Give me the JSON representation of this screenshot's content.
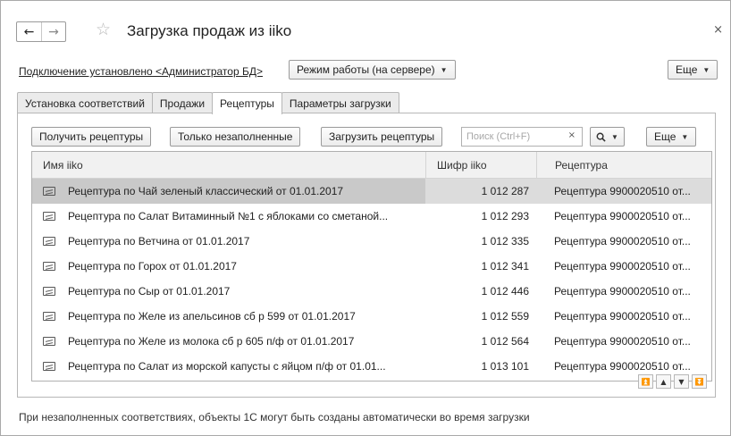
{
  "window": {
    "title": "Загрузка продаж из iiko",
    "close_label": "×",
    "back_label": "←",
    "forward_label": "→",
    "star_label": "☆"
  },
  "connection": {
    "status_link": "Подключение установлено <Администратор БД>",
    "mode_button": "Режим работы (на сервере)",
    "more_button": "Еще"
  },
  "tabs": [
    {
      "label": "Установка соответствий",
      "active": false
    },
    {
      "label": "Продажи",
      "active": false
    },
    {
      "label": "Рецептуры",
      "active": true
    },
    {
      "label": "Параметры загрузки",
      "active": false
    }
  ],
  "toolbar": {
    "get_recipes": "Получить рецептуры",
    "only_unfilled": "Только незаполненные",
    "load_recipes": "Загрузить рецептуры",
    "search_placeholder": "Поиск (Ctrl+F)",
    "search_value": "",
    "clear_label": "×",
    "search_icon_label": "🔍",
    "more_label": "Еще"
  },
  "table": {
    "columns": [
      "Имя iiko",
      "Шифр iiko",
      "Рецептура"
    ],
    "rows": [
      {
        "name": "Рецептура по Чай зеленый классический  от 01.01.2017",
        "code": "1 012 287",
        "recipe": "Рецептура 9900020510 от...",
        "selected": true
      },
      {
        "name": "Рецептура по Салат Витаминный №1 с яблоками со сметаной...",
        "code": "1 012 293",
        "recipe": "Рецептура 9900020510 от...",
        "selected": false
      },
      {
        "name": "Рецептура по Ветчина от 01.01.2017",
        "code": "1 012 335",
        "recipe": "Рецептура 9900020510 от...",
        "selected": false
      },
      {
        "name": "Рецептура по Горох от 01.01.2017",
        "code": "1 012 341",
        "recipe": "Рецептура 9900020510 от...",
        "selected": false
      },
      {
        "name": "Рецептура по Сыр от 01.01.2017",
        "code": "1 012 446",
        "recipe": "Рецептура 9900020510 от...",
        "selected": false
      },
      {
        "name": "Рецептура по Желе из апельсинов сб р 599 от 01.01.2017",
        "code": "1 012 559",
        "recipe": "Рецептура 9900020510 от...",
        "selected": false
      },
      {
        "name": "Рецептура по Желе из молока сб р 605 п/ф от 01.01.2017",
        "code": "1 012 564",
        "recipe": "Рецептура 9900020510 от...",
        "selected": false
      },
      {
        "name": "Рецептура по Салат из морской капусты с яйцом п/ф от 01.01...",
        "code": "1 013 101",
        "recipe": "Рецептура 9900020510 от...",
        "selected": false
      }
    ]
  },
  "scroll": {
    "first_label": "⏫",
    "up_label": "▲",
    "down_label": "▼",
    "last_label": "⏬"
  },
  "footer": {
    "note": "При незаполненных соответствиях, объекты 1С могут быть созданы автоматически во время загрузки"
  }
}
